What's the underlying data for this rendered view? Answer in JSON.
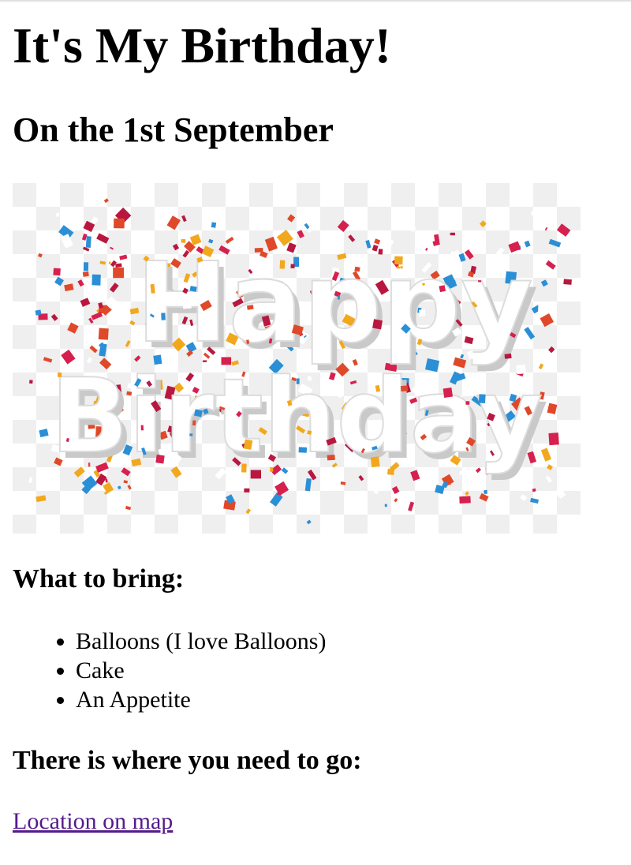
{
  "page": {
    "title": "It's My Birthday!",
    "date_heading": "On the 1st September"
  },
  "banner": {
    "line1": "Happy",
    "line2": "Birthday",
    "confetti_colors": [
      "#d6204e",
      "#f2a81d",
      "#2a8fd6",
      "#e0482a",
      "#ffffff",
      "#b8183f"
    ]
  },
  "bring": {
    "heading": "What to bring:",
    "items": [
      {
        "label": "Balloons (I love Balloons)"
      },
      {
        "label": "Cake"
      },
      {
        "label": "An Appetite"
      }
    ]
  },
  "location": {
    "heading": "There is where you need to go:",
    "link_label": "Location on map",
    "link_color": "#551a8b"
  }
}
